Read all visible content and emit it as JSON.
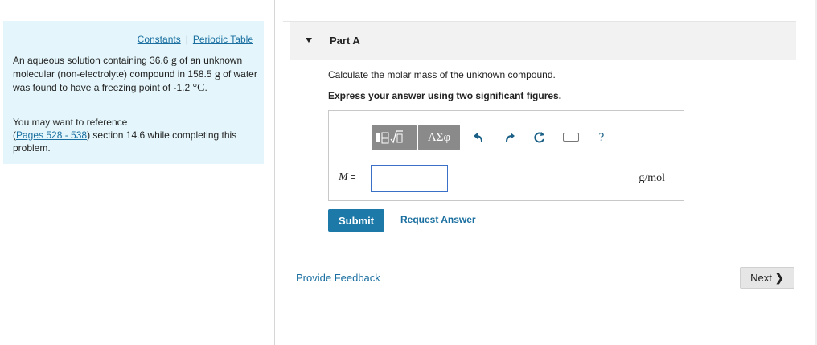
{
  "left_panel": {
    "links": [
      "Constants",
      "Periodic Table"
    ],
    "separator": "|",
    "problem": {
      "t1": "An aqueous solution containing 36.6",
      "u1": "g",
      "t2": " of an unknown molecular (non-electrolyte) compound in 158.5",
      "u2": "g",
      "t3": " of water was found to have a freezing point of -1.2",
      "u3": "°C",
      "t4": "."
    },
    "reference": {
      "lead": "You may want to reference",
      "link": "Pages 528 - 538",
      "tail": ") section 14.6 while completing this problem."
    }
  },
  "part": {
    "title": "Part A"
  },
  "question": "Calculate the molar mass of the unknown compound.",
  "instruction": "Express your answer using two significant figures.",
  "toolbar": {
    "greek_label": "ΑΣφ",
    "help_label": "?",
    "icons": [
      "templates-icon",
      "undo-icon",
      "redo-icon",
      "reset-icon",
      "keyboard-icon",
      "help-icon"
    ]
  },
  "answer": {
    "var": "M",
    "eq": "=",
    "value": "",
    "unit": "g/mol"
  },
  "actions": {
    "submit": "Submit",
    "request": "Request Answer",
    "feedback": "Provide Feedback",
    "next": "Next"
  },
  "colors": {
    "accent": "#1c79a8",
    "panel_bg": "#e4f6fb",
    "link": "#1a6fa0"
  }
}
